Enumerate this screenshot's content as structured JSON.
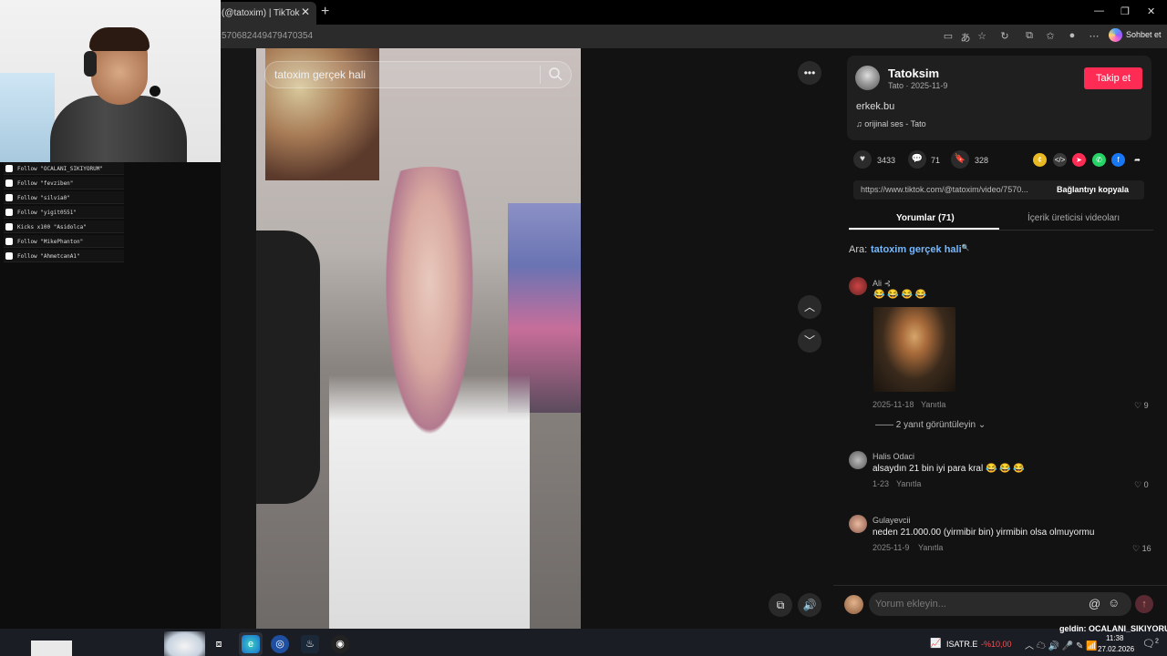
{
  "browser": {
    "tab_title": "(@tatoxim) | TikTok",
    "tab_close": "✕",
    "new_tab": "+",
    "url": "570682449479470354",
    "chat_button": "Sohbet et",
    "window_controls": [
      "—",
      "❐",
      "✕"
    ]
  },
  "video": {
    "search_text": "tatoxim gerçek hali"
  },
  "author": {
    "name": "Tatoksim",
    "meta": "Tato · 2025-11-9",
    "follow": "Takip et",
    "description": "erkek.bu",
    "music": "orijinal ses - Tato"
  },
  "stats": {
    "likes": "3433",
    "comments": "71",
    "saves": "328"
  },
  "link": {
    "url": "https://www.tiktok.com/@tatoxim/video/7570...",
    "copy": "Bağlantıyı kopyala"
  },
  "tabs": {
    "comments": "Yorumlar (71)",
    "creator_videos": "İçerik üreticisi videoları"
  },
  "related": {
    "label": "Ara:",
    "query": "tatoxim gerçek hali"
  },
  "comments": [
    {
      "user": "Ali ⊰",
      "text": "😂 😂 😂 😂",
      "date": "2025-11-18",
      "reply": "Yanıtla",
      "likes": "9",
      "replies": "2 yanıt görüntüleyin"
    },
    {
      "user": "Halis Odaci",
      "text": "alsaydın 21 bin iyi para kral 😂 😂 😂",
      "date": "1-23",
      "reply": "Yanıtla",
      "likes": "0"
    },
    {
      "user": "Gulayevcii",
      "text": "neden 21.000.00 (yirmibir bin) yirmibin olsa olmuyormu",
      "date": "2025-11-9",
      "reply": "Yanıtla",
      "likes": "16"
    }
  ],
  "comment_box": {
    "placeholder": "Yorum ekleyin..."
  },
  "alerts": [
    "Follow \"OCALANI_SIKIYORUM\"",
    "Follow \"fevziben\"",
    "Follow \"silvia0\"",
    "Follow \"yigit0551\"",
    "Kicks x100 \"Asidolca\"",
    "Follow \"MikePhanton\"",
    "Follow \"AhmetcanA1\""
  ],
  "taskbar": {
    "ticker_name": "ISATR.E",
    "ticker_value": "-%10,00",
    "time": "11:38",
    "date": "27.02.2026",
    "notifications": "2",
    "marquee": "geldin: OCALANI_SIKIYORUM"
  },
  "colors": {
    "accent": "#fe2c55",
    "link_blue": "#74b8ff",
    "background": "#121212"
  }
}
